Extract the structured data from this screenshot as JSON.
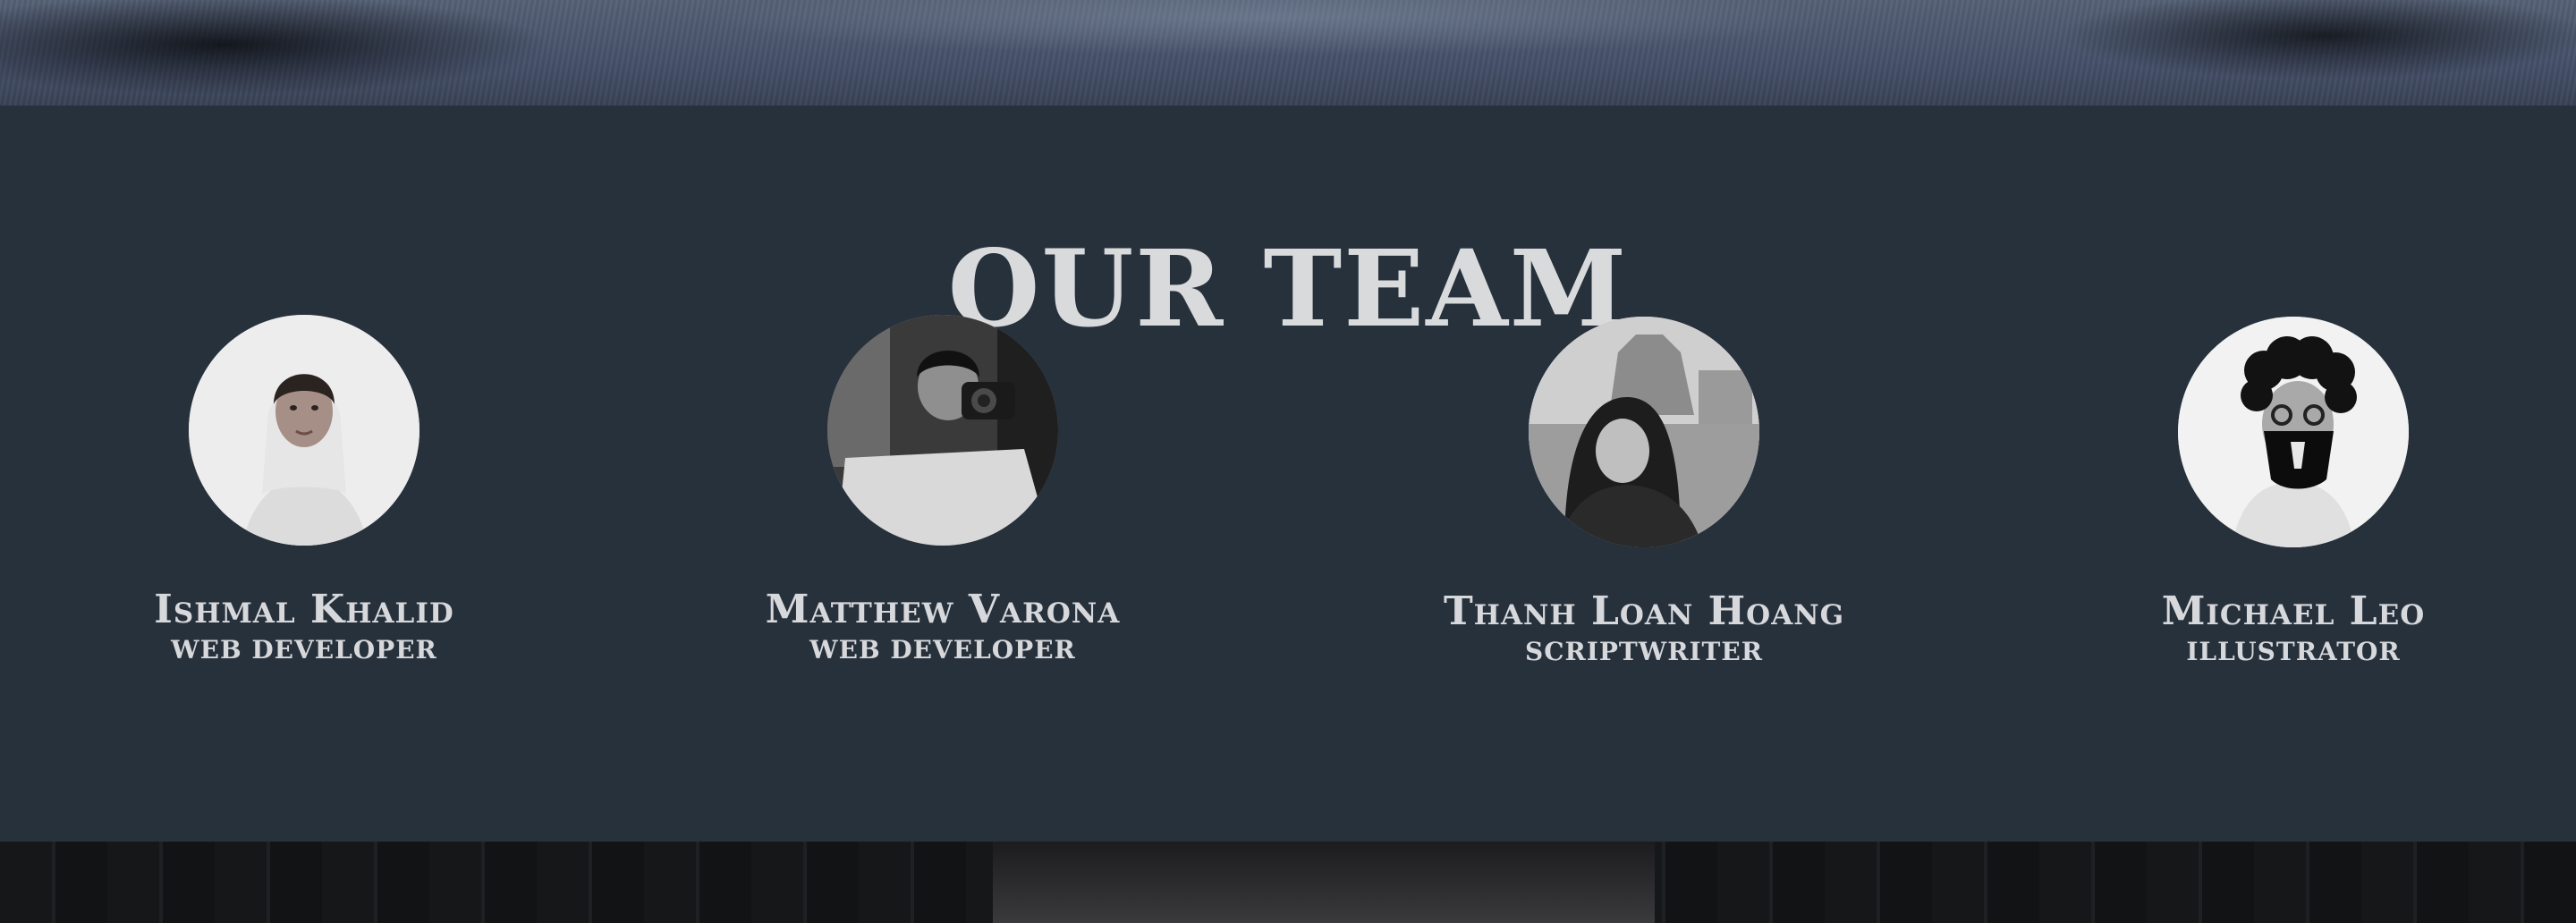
{
  "team": {
    "title": "OUR TEAM",
    "members": [
      {
        "name": "Ishmal Khalid",
        "role": "WEB DEVELOPER"
      },
      {
        "name": "Matthew Varona",
        "role": "WEB DEVELOPER"
      },
      {
        "name": "Thanh Loan Hoang",
        "role": "SCRIPTWRITER"
      },
      {
        "name": "Michael Leo",
        "role": "ILLUSTRATOR"
      }
    ]
  },
  "colors": {
    "section_background": "#27313c",
    "text": "#d9dadc",
    "hero_strip": "#4a5569",
    "bottom_strip": "#111214"
  }
}
